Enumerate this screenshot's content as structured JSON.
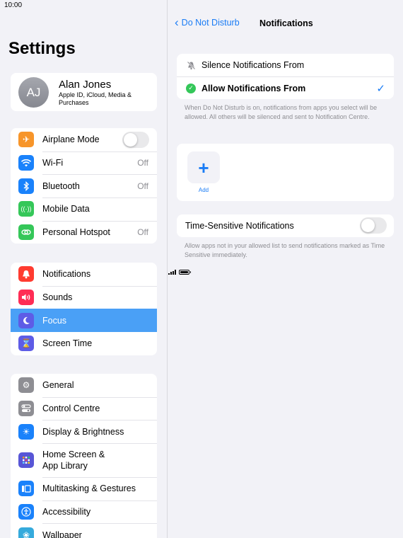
{
  "status": {
    "time": "10:00"
  },
  "left": {
    "title": "Settings",
    "profile": {
      "initials": "AJ",
      "name": "Alan Jones",
      "subtitle": "Apple ID, iCloud, Media & Purchases"
    },
    "group1": [
      {
        "label": "Airplane Mode",
        "icon": "airplane-icon",
        "color": "#f7952a",
        "value": "",
        "toggle": "off"
      },
      {
        "label": "Wi-Fi",
        "icon": "wifi-icon",
        "color": "#1a82fb",
        "value": "Off"
      },
      {
        "label": "Bluetooth",
        "icon": "bluetooth-icon",
        "color": "#1a82fb",
        "value": "Off"
      },
      {
        "label": "Mobile Data",
        "icon": "antenna-icon",
        "color": "#35c759",
        "value": ""
      },
      {
        "label": "Personal Hotspot",
        "icon": "hotspot-icon",
        "color": "#35c759",
        "value": "Off"
      }
    ],
    "group2": [
      {
        "label": "Notifications",
        "icon": "bell-icon",
        "color": "#ff3b30"
      },
      {
        "label": "Sounds",
        "icon": "speaker-icon",
        "color": "#ff2d55"
      },
      {
        "label": "Focus",
        "icon": "moon-icon",
        "color": "#5e5ce6",
        "selected": true
      },
      {
        "label": "Screen Time",
        "icon": "hourglass-icon",
        "color": "#5e5ce6"
      }
    ],
    "group3": [
      {
        "label": "General",
        "icon": "gear-icon",
        "color": "#8e8e93"
      },
      {
        "label": "Control Centre",
        "icon": "switches-icon",
        "color": "#8e8e93"
      },
      {
        "label": "Display & Brightness",
        "icon": "sun-icon",
        "color": "#1a82fb"
      },
      {
        "label_line1": "Home Screen &",
        "label_line2": "App Library",
        "icon": "grid-icon",
        "color": "#5856d6"
      },
      {
        "label": "Multitasking & Gestures",
        "icon": "multitasking-icon",
        "color": "#1a82fb"
      },
      {
        "label": "Accessibility",
        "icon": "accessibility-icon",
        "color": "#1a82fb"
      },
      {
        "label": "Wallpaper",
        "icon": "flower-icon",
        "color": "#35aadc"
      }
    ]
  },
  "right": {
    "back_label": "Do Not Disturb",
    "title": "Notifications",
    "options": [
      {
        "label": "Silence Notifications From",
        "icon": "bell-slash-icon"
      },
      {
        "label": "Allow Notifications From",
        "icon": "check-badge-icon",
        "checked": true
      }
    ],
    "allow_note": "When Do Not Disturb is on, notifications from apps you select will be allowed. All others will be silenced and sent to Notification Centre.",
    "add_label": "Add",
    "time_sensitive": {
      "label": "Time-Sensitive Notifications",
      "toggle": "off"
    },
    "time_sensitive_note": "Allow apps not in your allowed list to send notifications marked as Time Sensitive immediately.",
    "accent_color": "#1a7cf5"
  }
}
